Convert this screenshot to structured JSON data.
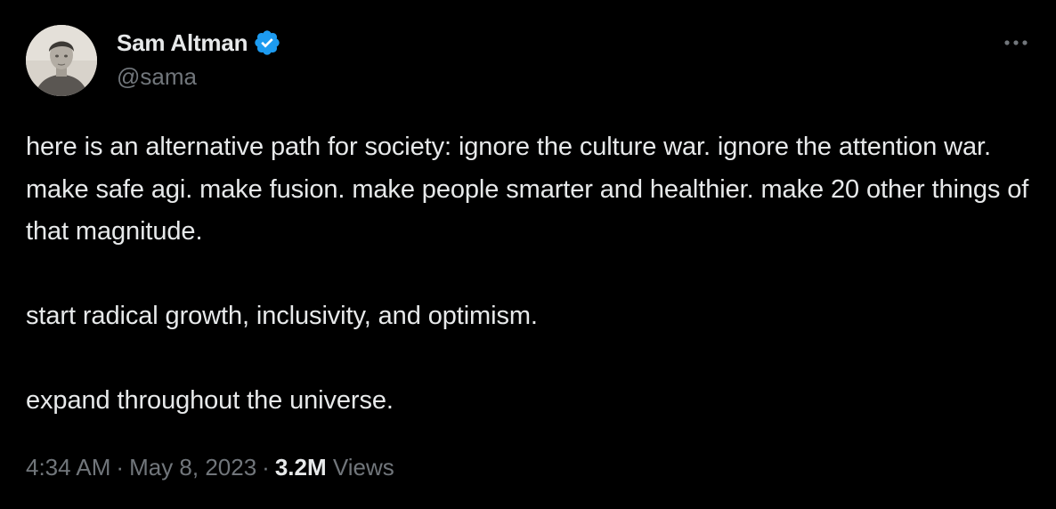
{
  "author": {
    "display_name": "Sam Altman",
    "handle": "@sama",
    "verified_icon": "verified-badge-icon",
    "verified_color": "#1d9bf0"
  },
  "more_icon": "more-horizontal-icon",
  "tweet": {
    "paragraphs": [
      "here is an alternative path for society: ignore the culture war. ignore the attention war. make safe agi. make fusion. make people smarter and healthier. make 20 other things of that magnitude.",
      "start radical growth, inclusivity, and optimism.",
      "expand throughout the universe."
    ]
  },
  "meta": {
    "time": "4:34 AM",
    "separator": "·",
    "date": "May 8, 2023",
    "views_count": "3.2M",
    "views_label": "Views"
  },
  "colors": {
    "background": "#000000",
    "text_primary": "#e7e9ea",
    "text_secondary": "#71767b",
    "accent": "#1d9bf0"
  }
}
